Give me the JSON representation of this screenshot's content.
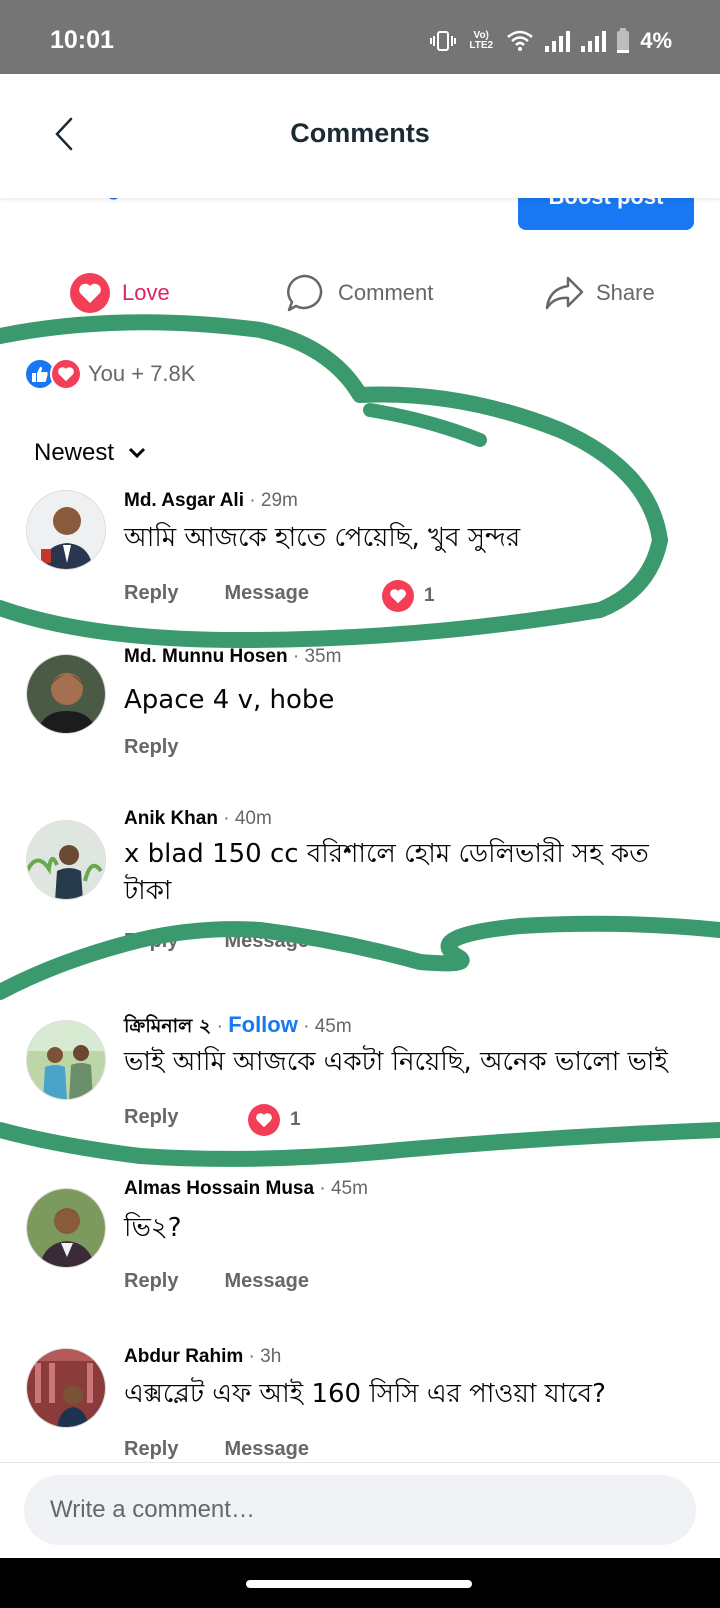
{
  "status_bar": {
    "time": "10:01",
    "network_label": "Vo) LTE2",
    "battery": "4%"
  },
  "header": {
    "title": "Comments",
    "back_icon": "chevron-left-icon"
  },
  "partial_content": {
    "insights_link": "See insights and ads",
    "boost_button": "Boost post"
  },
  "post_actions": {
    "love_label": "Love",
    "comment_label": "Comment",
    "share_label": "Share"
  },
  "reactions_summary": {
    "text": "You + 7.8K",
    "icons": [
      "like-icon",
      "love-icon"
    ]
  },
  "sort": {
    "label": "Newest"
  },
  "comments": [
    {
      "name": "Md. Asgar Ali",
      "time": "29m",
      "text": "আমি আজকে হাতে পেয়েছি, খুব সুন্দর",
      "actions": [
        "Reply",
        "Message"
      ],
      "reaction_count": "1"
    },
    {
      "name": "Md. Munnu Hosen",
      "time": "35m",
      "text": "Apace 4 v, hobe",
      "actions": [
        "Reply"
      ]
    },
    {
      "name": "Anik Khan",
      "time": "40m",
      "text": "x blad 150 cc বরিশালে হোম ডেলিভারী সহ কত টাকা",
      "actions": [
        "Reply",
        "Message"
      ]
    },
    {
      "name": "ক্রিমিনাল ২",
      "follow": "Follow",
      "time": "45m",
      "text": "ভাই আমি আজকে একটা নিয়েছি, অনেক ভালো ভাই",
      "actions": [
        "Reply"
      ],
      "reaction_count": "1"
    },
    {
      "name": "Almas Hossain Musa",
      "time": "45m",
      "text": "ভি২?",
      "actions": [
        "Reply",
        "Message"
      ]
    },
    {
      "name": "Abdur Rahim",
      "time": "3h",
      "text": "এক্সব্লেট এফ আই 160 সিসি এর পাওয়া যাবে?",
      "actions": [
        "Reply",
        "Message"
      ]
    }
  ],
  "composer": {
    "placeholder": "Write a comment…"
  },
  "colors": {
    "accent": "#1877f2",
    "love": "#f33e58",
    "annotation": "#3a9a6e",
    "secondary_text": "#65676b"
  }
}
